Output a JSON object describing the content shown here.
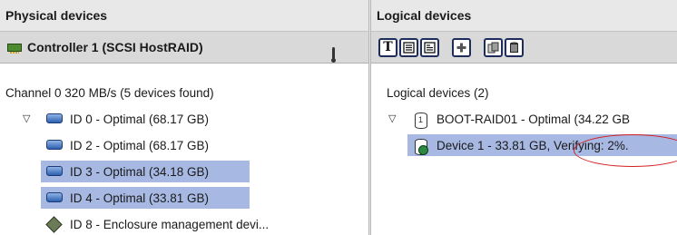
{
  "physical": {
    "header": "Physical devices",
    "controller": {
      "label": "Controller 1 (SCSI HostRAID)",
      "icon": "pci-card-icon",
      "status_icon": "thermometer-icon"
    },
    "channel": "Channel 0  320 MB/s (5 devices found)",
    "devices": [
      {
        "label": "ID 0 - Optimal (68.17 GB)",
        "selected": false,
        "expanded": true,
        "icon": "hard-disk-icon"
      },
      {
        "label": "ID 2 - Optimal (68.17 GB)",
        "selected": false,
        "icon": "hard-disk-icon"
      },
      {
        "label": "ID 3 - Optimal (34.18 GB)",
        "selected": true,
        "icon": "hard-disk-icon"
      },
      {
        "label": "ID 4 - Optimal (33.81 GB)",
        "selected": true,
        "icon": "hard-disk-icon"
      },
      {
        "label": "ID 8 - Enclosure management devi...",
        "selected": false,
        "icon": "enclosure-icon"
      }
    ]
  },
  "logical": {
    "header": "Logical devices",
    "toolbar": {
      "buttons": [
        {
          "icon": "text-view-icon",
          "glyph": "T"
        },
        {
          "icon": "list-view-icon"
        },
        {
          "icon": "detail-view-icon"
        },
        {
          "icon": "add-logical-device-icon"
        },
        {
          "icon": "copy-icon"
        },
        {
          "icon": "delete-icon"
        }
      ]
    },
    "section": "Logical devices (2)",
    "items": [
      {
        "label": "BOOT-RAID01 - Optimal (34.22 GB",
        "badge": "1",
        "expanded": true,
        "icon": "logical-drive-icon"
      },
      {
        "label": "Device 1 - 33.81 GB, Verifying: 2%.",
        "selected": true,
        "icon": "verifying-drive-icon"
      }
    ]
  },
  "colors": {
    "selection": "#a7b9e3",
    "annotation": "#d31f1f",
    "header_bg": "#e8e8e8",
    "toolbar_bg": "#d9d9d9"
  }
}
